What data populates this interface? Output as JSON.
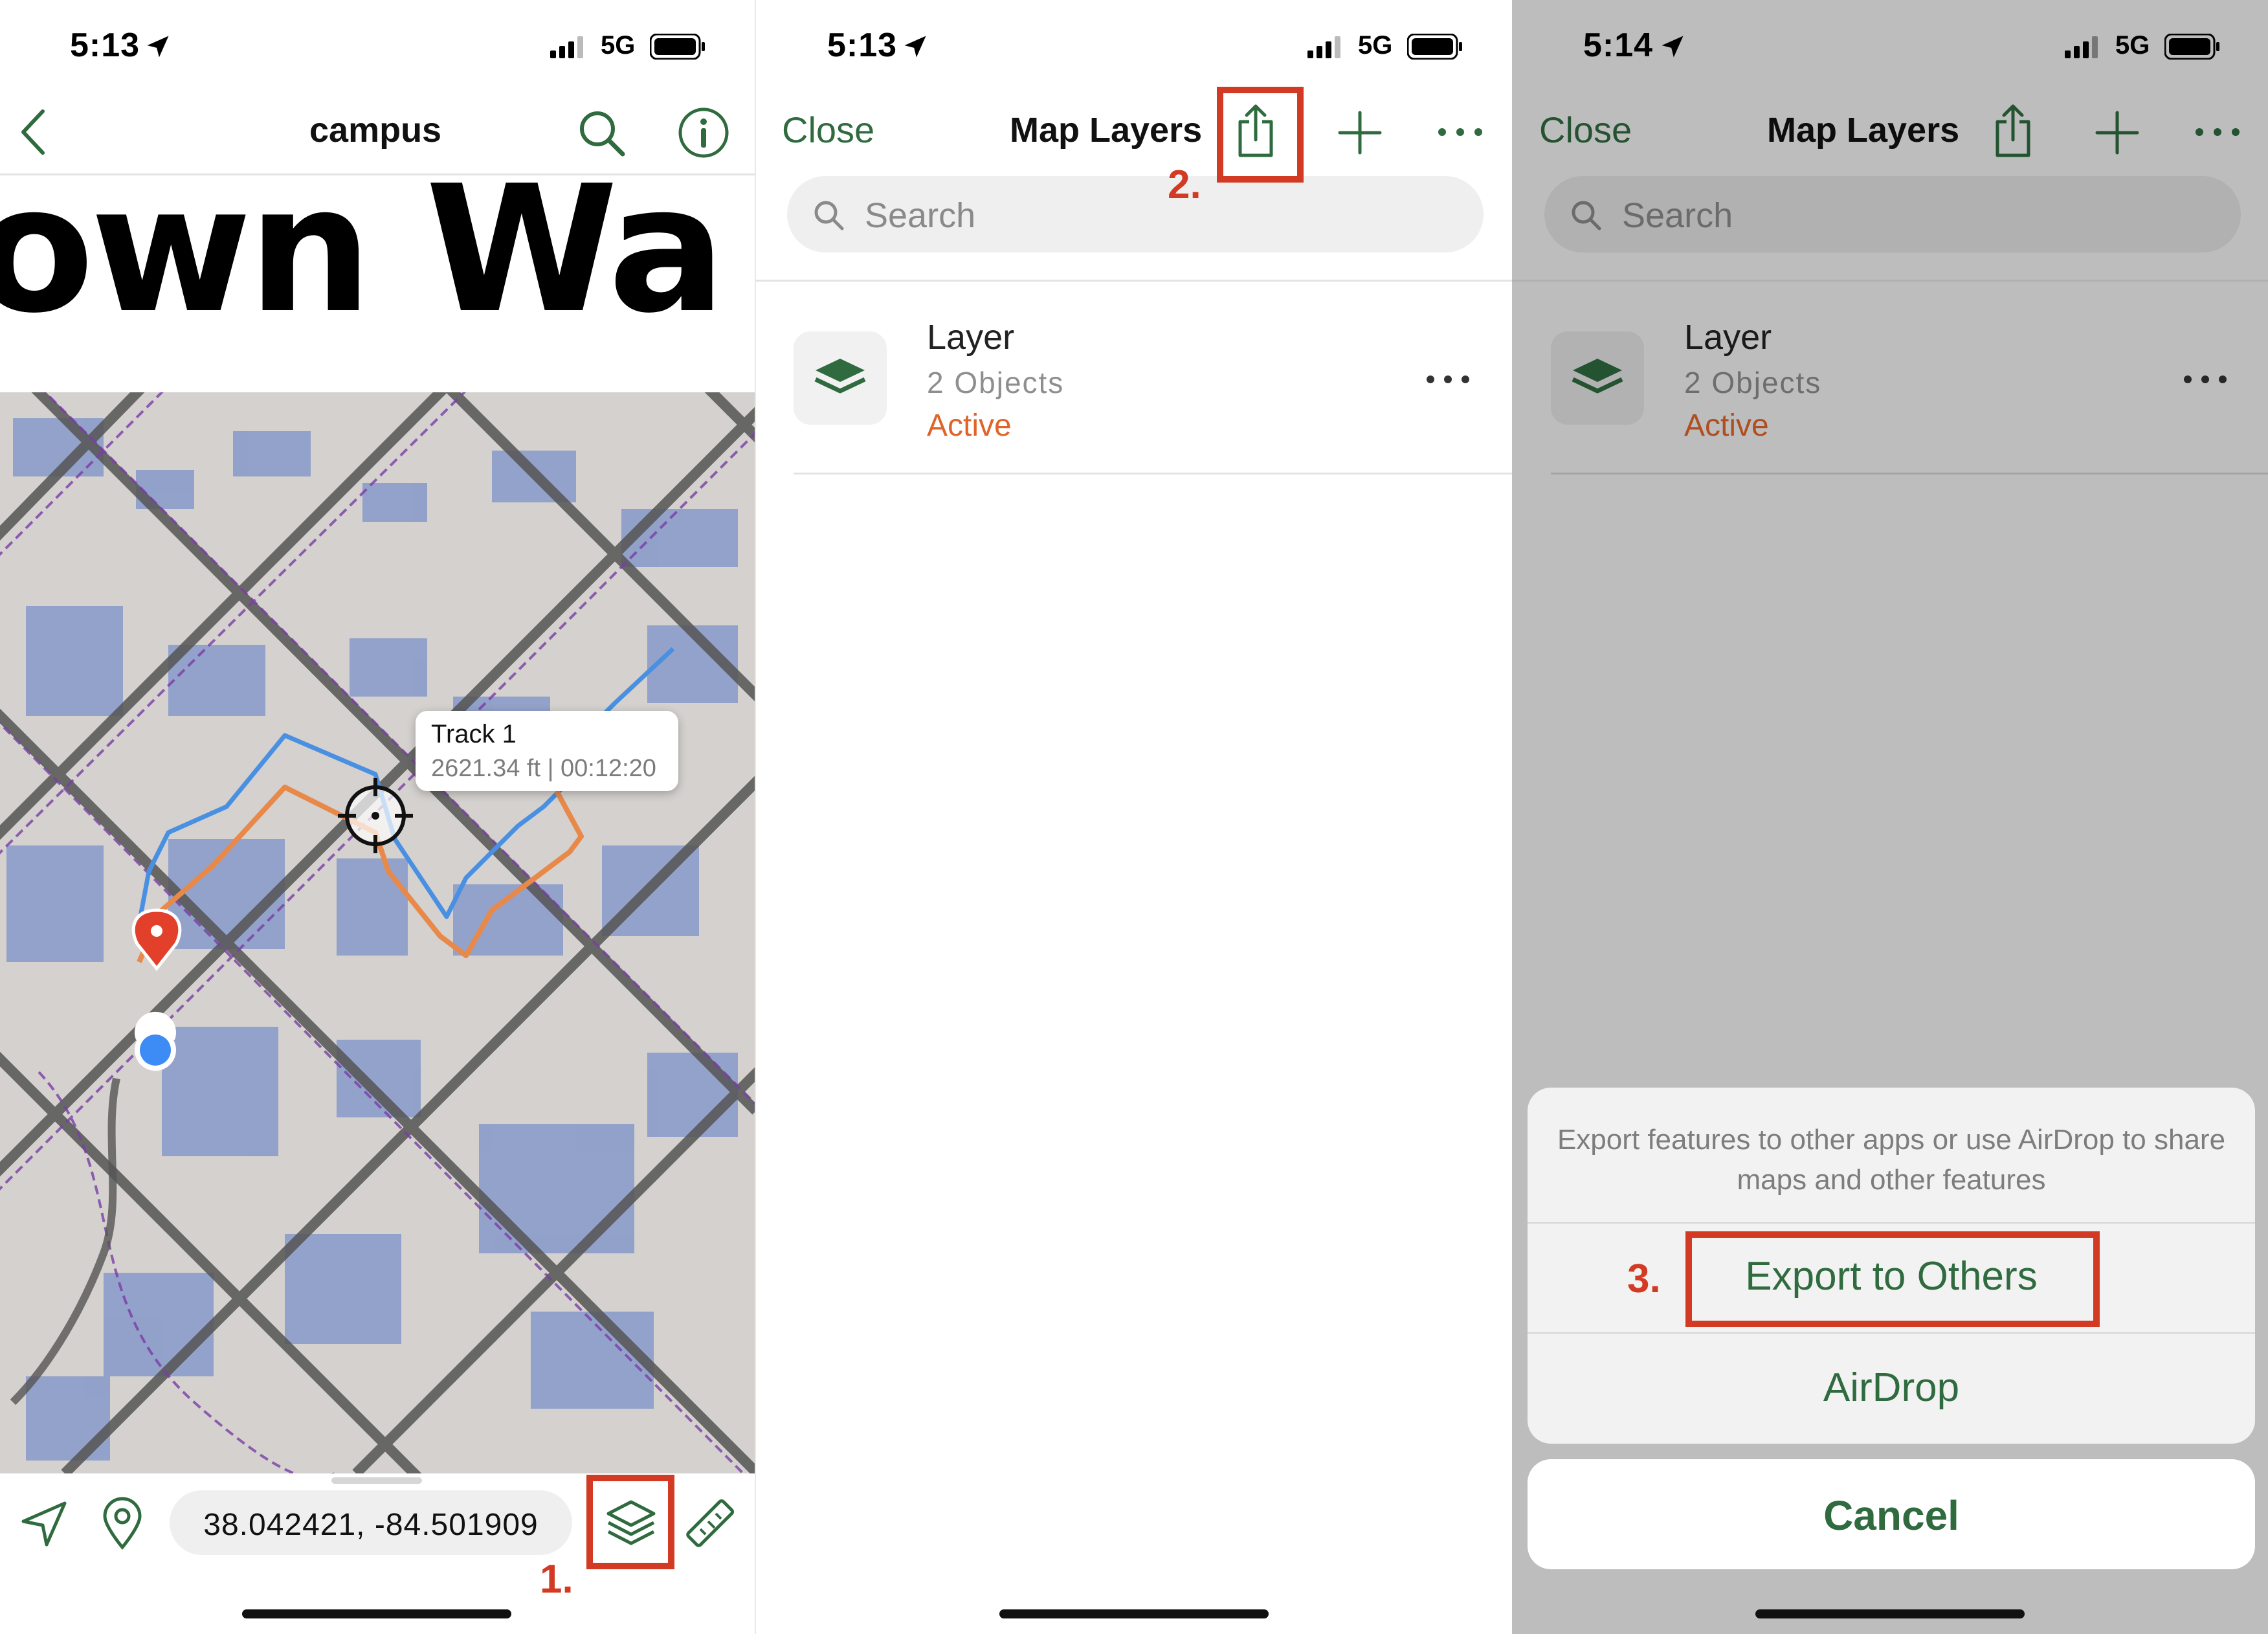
{
  "colors": {
    "accent": "#2f6b3f",
    "active": "#e0642a",
    "annotation": "#d23a23",
    "track": "#e8894a",
    "track_alt": "#4a90e2",
    "pin": "#e3402b",
    "location_dot": "#3d8cf5"
  },
  "panel1": {
    "status_time": "5:13",
    "network": "5G",
    "nav_title": "campus",
    "back_icon": "chevron-left-icon",
    "search_icon": "search-icon",
    "info_icon": "info-icon",
    "banner_text": "own Wa",
    "callout": {
      "title": "Track 1",
      "detail": "2621.34 ft | 00:12:20"
    },
    "coordinates": "38.042421, -84.501909",
    "toolbar_icons": [
      "navigate-icon",
      "pin-icon",
      "layers-icon",
      "ruler-icon"
    ],
    "step_label": "1."
  },
  "panel2": {
    "status_time": "5:13",
    "network": "5G",
    "close_label": "Close",
    "title": "Map Layers",
    "search_placeholder": "Search",
    "layer": {
      "name": "Layer",
      "count": "2 Objects",
      "status": "Active"
    },
    "step_label": "2."
  },
  "panel3": {
    "status_time": "5:14",
    "network": "5G",
    "close_label": "Close",
    "title": "Map Layers",
    "search_placeholder": "Search",
    "layer": {
      "name": "Layer",
      "count": "2 Objects",
      "status": "Active"
    },
    "sheet": {
      "message": "Export features to other apps or use AirDrop to share maps and other features",
      "export_label": "Export to Others",
      "airdrop_label": "AirDrop",
      "cancel_label": "Cancel"
    },
    "step_label": "3."
  }
}
